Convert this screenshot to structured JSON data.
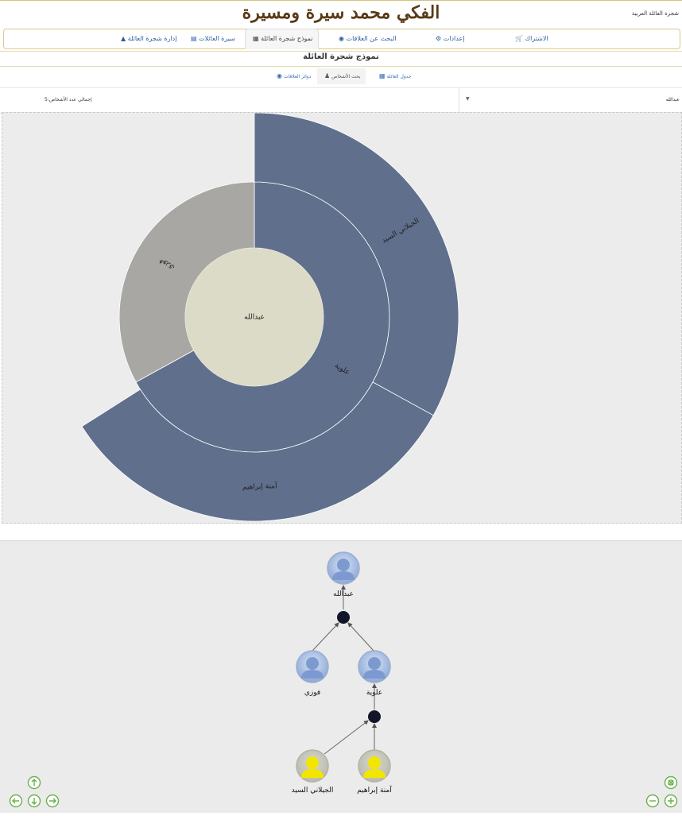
{
  "site": {
    "title": "الفكي محمد سيرة ومسيرة",
    "top_right_label": "شجرة العائلة العربية"
  },
  "nav": {
    "items": [
      {
        "key": "subscription",
        "label": "الاشتراك",
        "icon": "cart-icon"
      },
      {
        "key": "settings",
        "label": "إعدادات",
        "icon": "gear-icon"
      },
      {
        "key": "search",
        "label": "البحث عن العلاقات",
        "icon": "globe-icon"
      },
      {
        "key": "model",
        "label": "نموذج شجرة العائلة",
        "icon": "table-icon",
        "active": true
      },
      {
        "key": "biography",
        "label": "سيرة العائلات",
        "icon": "id-card-icon"
      },
      {
        "key": "manage",
        "label": "إدارة شجرة العائلة",
        "icon": "sitemap-icon"
      }
    ]
  },
  "page": {
    "subtitle": "نموذج شجرة العائلة"
  },
  "tabs": [
    {
      "key": "table",
      "label": "جدول العائلة",
      "icon": "table-icon"
    },
    {
      "key": "people",
      "label": "بحث الأشخاص",
      "icon": "person-icon",
      "active": true
    },
    {
      "key": "circles",
      "label": "دوائر العلاقات",
      "icon": "circle-icon"
    }
  ],
  "filter": {
    "selected_person": "عبدالله",
    "total_label": "إجمالي عدد الأشخاص:5"
  },
  "chart_data": {
    "type": "sunburst",
    "center": "عبدالله",
    "ring1": [
      {
        "name": "علوية",
        "share": 0.67,
        "color": "#5f6f8c"
      },
      {
        "name": "فوزي",
        "share": 0.33,
        "color": "#a8a7a3"
      }
    ],
    "ring2": [
      {
        "name": "الجيلاني السيد",
        "parent": "علوية",
        "share": 0.33,
        "color": "#5f6f8c"
      },
      {
        "name": "آمنة إبراهيم",
        "parent": "علوية",
        "share": 0.33,
        "color": "#5f6f8c"
      }
    ],
    "center_color": "#dcdbc8"
  },
  "tree": {
    "nodes": [
      {
        "id": "n1",
        "name": "عبدالله",
        "type": "blue"
      },
      {
        "id": "n2",
        "name": "فوزي",
        "type": "blue"
      },
      {
        "id": "n3",
        "name": "علوية",
        "type": "blue"
      },
      {
        "id": "n4",
        "name": "الجيلاني السيد",
        "type": "yellow"
      },
      {
        "id": "n5",
        "name": "آمنة إبراهيم",
        "type": "yellow"
      }
    ]
  },
  "controls": {
    "pan": [
      "up-arrow-icon",
      "left-arrow-icon",
      "down-arrow-icon",
      "right-arrow-icon"
    ],
    "zoom": [
      "fit-icon",
      "zoom-out-icon",
      "zoom-in-icon"
    ],
    "color": "#6ab04c"
  }
}
